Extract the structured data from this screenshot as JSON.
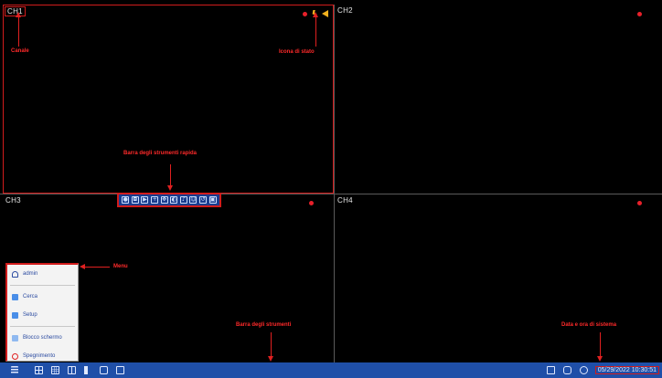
{
  "channels": [
    {
      "label": "CH1"
    },
    {
      "label": "CH2"
    },
    {
      "label": "CH3"
    },
    {
      "label": "CH4"
    }
  ],
  "annotations": {
    "channel": "Canale",
    "status": "Icona di stato",
    "quickbar": "Barra degli strumenti rapida",
    "menu": "Menu",
    "toolbar": "Barra degli strumenti",
    "datetime": "Data e ora di sistema"
  },
  "quickbar_icons": [
    "record-icon",
    "snapshot-icon",
    "playback-icon",
    "zoom-icon",
    "ptz-icon",
    "color-icon",
    "audio-icon",
    "face-icon",
    "reverse-icon",
    "lock-icon"
  ],
  "menu": {
    "items": [
      {
        "label": "admin",
        "icon": "user-icon"
      },
      {
        "label": "Cerca",
        "icon": "search-icon"
      },
      {
        "label": "Setup",
        "icon": "setup-icon"
      },
      {
        "label": "Blocco schermo",
        "icon": "lock-screen-icon"
      },
      {
        "label": "Spegnimento",
        "icon": "power-icon"
      }
    ]
  },
  "taskbar": {
    "datetime": "05/29/2022 10:30:51"
  },
  "colors": {
    "taskbar": "#1f4fa8",
    "annotation": "#ff2a2a",
    "record": "#e8202a",
    "status": "#f2b01e"
  }
}
